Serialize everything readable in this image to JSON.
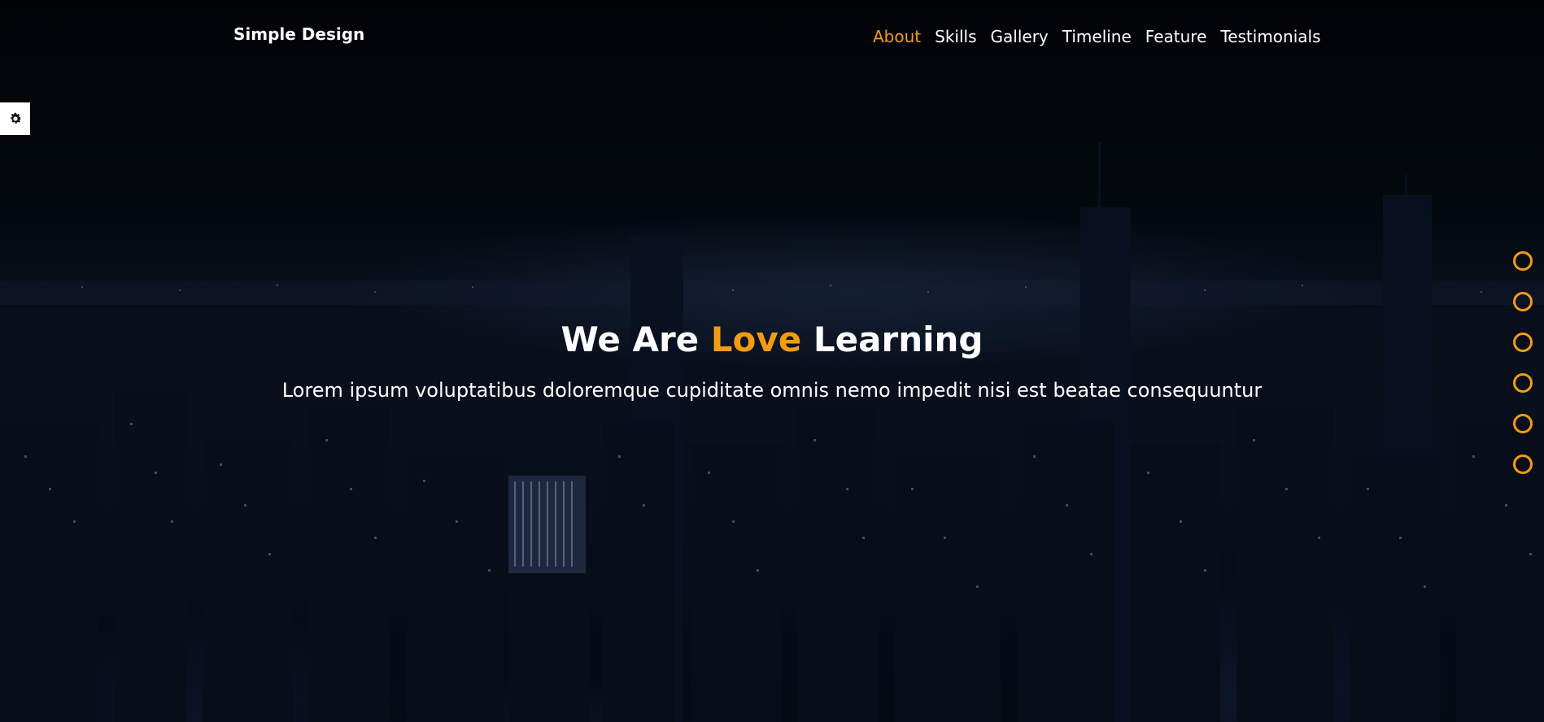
{
  "header": {
    "brand": "Simple Design",
    "nav": [
      {
        "label": "About",
        "active": true
      },
      {
        "label": "Skills",
        "active": false
      },
      {
        "label": "Gallery",
        "active": false
      },
      {
        "label": "Timeline",
        "active": false
      },
      {
        "label": "Feature",
        "active": false
      },
      {
        "label": "Testimonials",
        "active": false
      }
    ]
  },
  "settings": {
    "icon": "gear-icon"
  },
  "hero": {
    "headline_part1": "We Are ",
    "headline_accent": "Love",
    "headline_part2": " Learning",
    "subtitle": "Lorem ipsum voluptatibus doloremque cupiditate omnis nemo impedit nisi est beatae consequuntur"
  },
  "side_nav": {
    "dot_count": 6
  },
  "colors": {
    "accent": "#f39c12",
    "text": "#ffffff",
    "background": "#02060b"
  }
}
